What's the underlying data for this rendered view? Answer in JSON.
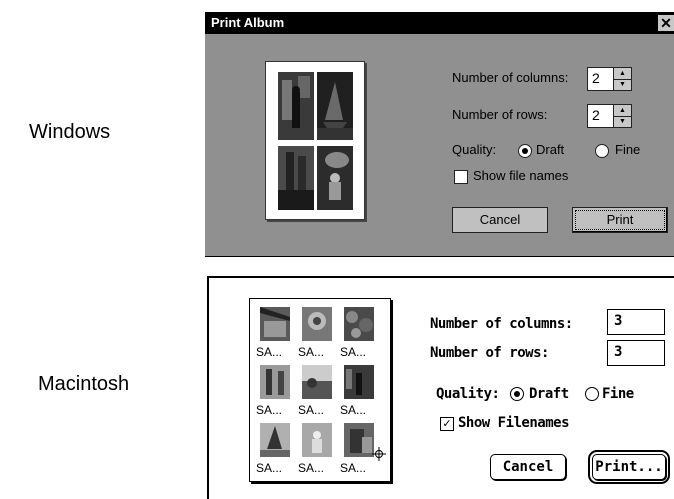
{
  "labels": {
    "windows": "Windows",
    "macintosh": "Macintosh"
  },
  "windows_dialog": {
    "title": "Print Album",
    "close_glyph": "✕",
    "columns_label": "Number of columns:",
    "columns_value": "2",
    "rows_label": "Number of rows:",
    "rows_value": "2",
    "quality_label": "Quality:",
    "quality_options": [
      "Draft",
      "Fine"
    ],
    "quality_selected": "Draft",
    "show_names_label": "Show file names",
    "show_names_checked": false,
    "cancel_label": "Cancel",
    "print_label": "Print"
  },
  "mac_dialog": {
    "captions": [
      "SA...",
      "SA...",
      "SA...",
      "SA...",
      "SA...",
      "SA...",
      "SA...",
      "SA...",
      "SA..."
    ],
    "columns_label": "Number of columns:",
    "columns_value": "3",
    "rows_label": "Number of rows:",
    "rows_value": "3",
    "quality_label": "Quality:",
    "quality_options": [
      "Draft",
      "Fine"
    ],
    "quality_selected": "Draft",
    "show_names_label": "Show Filenames",
    "show_names_checked": true,
    "check_glyph": "✓",
    "cancel_label": "Cancel",
    "print_label": "Print..."
  }
}
